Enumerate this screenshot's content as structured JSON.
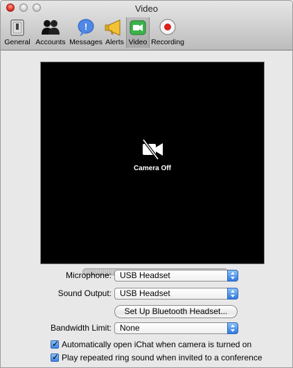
{
  "window": {
    "title": "Video"
  },
  "toolbar": {
    "items": [
      {
        "label": "General",
        "icon": "switch-icon"
      },
      {
        "label": "Accounts",
        "icon": "people-icon"
      },
      {
        "label": "Messages",
        "icon": "speech-bubble-icon"
      },
      {
        "label": "Alerts",
        "icon": "megaphone-icon"
      },
      {
        "label": "Video",
        "icon": "video-camera-icon",
        "selected": true
      },
      {
        "label": "Recording",
        "icon": "record-icon"
      }
    ]
  },
  "preview": {
    "status": "Camera Off",
    "icon": "camera-off-icon"
  },
  "form": {
    "microphone": {
      "label": "Microphone:",
      "value": "USB Headset"
    },
    "sound_output": {
      "label": "Sound Output:",
      "value": "USB Headset"
    },
    "bluetooth_button": "Set Up Bluetooth Headset...",
    "bandwidth": {
      "label": "Bandwidth Limit:",
      "value": "None"
    },
    "checkboxes": [
      {
        "label": "Automatically open iChat when camera is turned on",
        "checked": true
      },
      {
        "label": "Play repeated ring sound when invited to a conference",
        "checked": true
      }
    ]
  },
  "colors": {
    "selected_tab": "#b0b0b0",
    "accent": "#3d82e4",
    "preview_bg": "#000000"
  }
}
